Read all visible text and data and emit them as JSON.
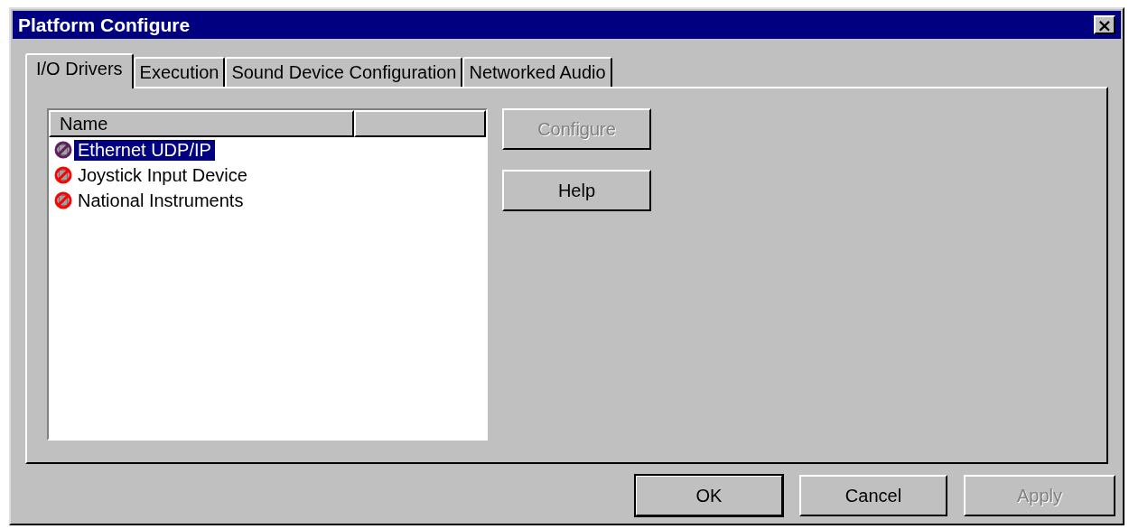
{
  "window": {
    "title": "Platform Configure",
    "close": "×"
  },
  "tabs": [
    {
      "label": "I/O Drivers",
      "selected": true
    },
    {
      "label": "Execution",
      "selected": false
    },
    {
      "label": "Sound Device Configuration",
      "selected": false
    },
    {
      "label": "Networked Audio",
      "selected": false
    }
  ],
  "list": {
    "columns": [
      "Name"
    ],
    "rows": [
      {
        "name": "Ethernet UDP/IP",
        "selected": true
      },
      {
        "name": "Joystick Input Device",
        "selected": false
      },
      {
        "name": "National Instruments",
        "selected": false
      }
    ]
  },
  "side_buttons": [
    {
      "label": "Configure",
      "disabled": true
    },
    {
      "label": "Help",
      "disabled": false
    }
  ],
  "buttons": [
    {
      "label": "OK",
      "disabled": false,
      "default": true
    },
    {
      "label": "Cancel",
      "disabled": false,
      "default": false
    },
    {
      "label": "Apply",
      "disabled": true,
      "default": false
    }
  ]
}
